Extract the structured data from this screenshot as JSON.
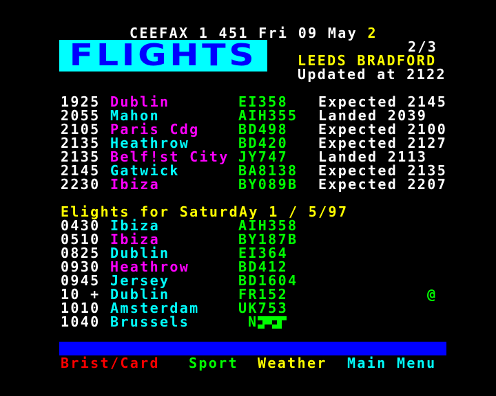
{
  "header": {
    "service": "CEEFAX",
    "page": "1 451",
    "day": "Fri",
    "date": "09 May",
    "clock": "2"
  },
  "banner": {
    "title": "FLIGHTS"
  },
  "subpage": "2/3",
  "airport": "LEEDS BRADFORD",
  "updated": "Updated at 2122",
  "today_flights": [
    {
      "time": "1925",
      "dest": "Dublin",
      "flight": "EI358",
      "status": "Expected 2145"
    },
    {
      "time": "2055",
      "dest": "Mahon",
      "flight": "AIH355",
      "status": "Landed 2039"
    },
    {
      "time": "2105",
      "dest": "Paris Cdg",
      "flight": "BD498",
      "status": "Expected 2100"
    },
    {
      "time": "2135",
      "dest": "Heathrow",
      "flight": "BD420",
      "status": "Expected 2127"
    },
    {
      "time": "2135",
      "dest": "Belf!st City",
      "flight": "JY747",
      "status": "Landed 2113"
    },
    {
      "time": "2145",
      "dest": "Gatwick",
      "flight": "BA8138",
      "status": "Expected 2135"
    },
    {
      "time": "2230",
      "dest": "Ibiza",
      "flight": "BY089B",
      "status": "Expected 2207"
    }
  ],
  "tomorrow_heading": "Elights for SaturdAy 1 / 5/97",
  "tomorrow_flights": [
    {
      "time": "0430",
      "dest": "Ibiza",
      "flight": "AIH358",
      "extra": ""
    },
    {
      "time": "0510",
      "dest": "Ibiza",
      "flight": "BY187B",
      "extra": ""
    },
    {
      "time": "0825",
      "dest": "Dublin",
      "flight": "EI364",
      "extra": ""
    },
    {
      "time": "0930",
      "dest": "Heathrow",
      "flight": "BD412",
      "extra": ""
    },
    {
      "time": "0945",
      "dest": "Jersey",
      "flight": "BD1604",
      "extra": ""
    },
    {
      "time": "10 +",
      "dest": "Dublin",
      "flight": "FR152",
      "extra": "@"
    },
    {
      "time": "1010",
      "dest": "Amsterdam",
      "flight": "UK753",
      "extra": ""
    },
    {
      "time": "1040",
      "dest": "Brussels",
      "flight": "N",
      "extra": ""
    }
  ],
  "fastext": {
    "red": "Brist/Card",
    "green": "Sport",
    "yellow": "Weather",
    "cyan": "Main Menu"
  },
  "colors": {
    "background": "#000000",
    "white": "#ffffff",
    "yellow": "#ffff00",
    "cyan": "#00ffff",
    "magenta": "#ff00ff",
    "green": "#00ff00",
    "red": "#ff0000",
    "blue": "#0000ff"
  }
}
